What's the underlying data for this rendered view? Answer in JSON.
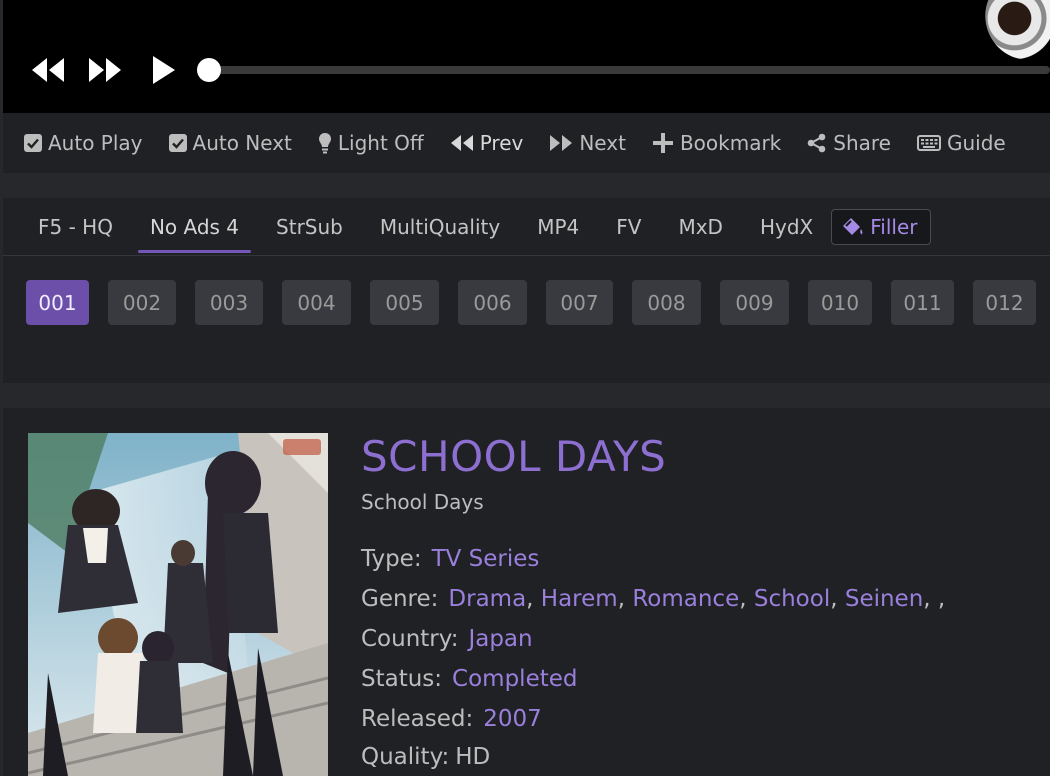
{
  "options": {
    "auto_play": "Auto Play",
    "auto_next": "Auto Next",
    "light_off": "Light Off",
    "prev": "Prev",
    "next": "Next",
    "bookmark": "Bookmark",
    "share": "Share",
    "guide": "Guide"
  },
  "servers": {
    "tabs": [
      "F5 - HQ",
      "No Ads 4",
      "StrSub",
      "MultiQuality",
      "MP4",
      "FV",
      "MxD",
      "HydX"
    ],
    "active_tab": "No Ads 4",
    "filler_label": "Filler"
  },
  "episodes": [
    "001",
    "002",
    "003",
    "004",
    "005",
    "006",
    "007",
    "008",
    "009",
    "010",
    "011",
    "012"
  ],
  "active_episode": "001",
  "anime": {
    "title": "SCHOOL DAYS",
    "subtitle": "School Days",
    "type_label": "Type:",
    "type": "TV Series",
    "genre_label": "Genre:",
    "genres": [
      "Drama",
      "Harem",
      "Romance",
      "School",
      "Seinen"
    ],
    "genre_trailing": ", ,",
    "country_label": "Country:",
    "country": "Japan",
    "status_label": "Status:",
    "status": "Completed",
    "released_label": "Released:",
    "released": "2007",
    "quality_label": "Quality:",
    "quality": "HD"
  },
  "colors": {
    "accent": "#8d6fd1",
    "accent_button": "#6b4fa8",
    "panel": "#202124",
    "page": "#27282c"
  }
}
